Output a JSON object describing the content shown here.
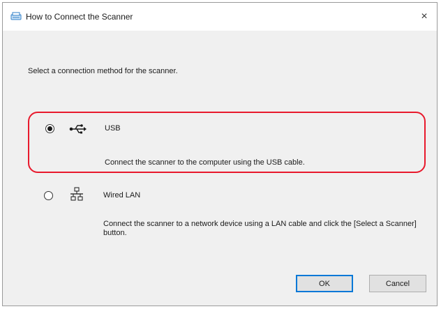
{
  "window": {
    "title": "How to Connect the Scanner",
    "close_glyph": "×",
    "title_icon": "scanner-icon"
  },
  "instruction": "Select a connection method for the scanner.",
  "options": [
    {
      "label": "USB",
      "description": "Connect the scanner to the computer using the USB cable.",
      "selected": true,
      "icon": "usb-icon",
      "highlight_color": "#e8192c"
    },
    {
      "label": "Wired LAN",
      "description": "Connect the scanner to a network device using a LAN cable and click the [Select a Scanner] button.",
      "selected": false,
      "icon": "network-icon"
    }
  ],
  "buttons": {
    "ok_label": "OK",
    "cancel_label": "Cancel"
  },
  "colors": {
    "accent": "#0078d7",
    "highlight": "#e8192c",
    "dialog_bg": "#f0f0f0"
  }
}
